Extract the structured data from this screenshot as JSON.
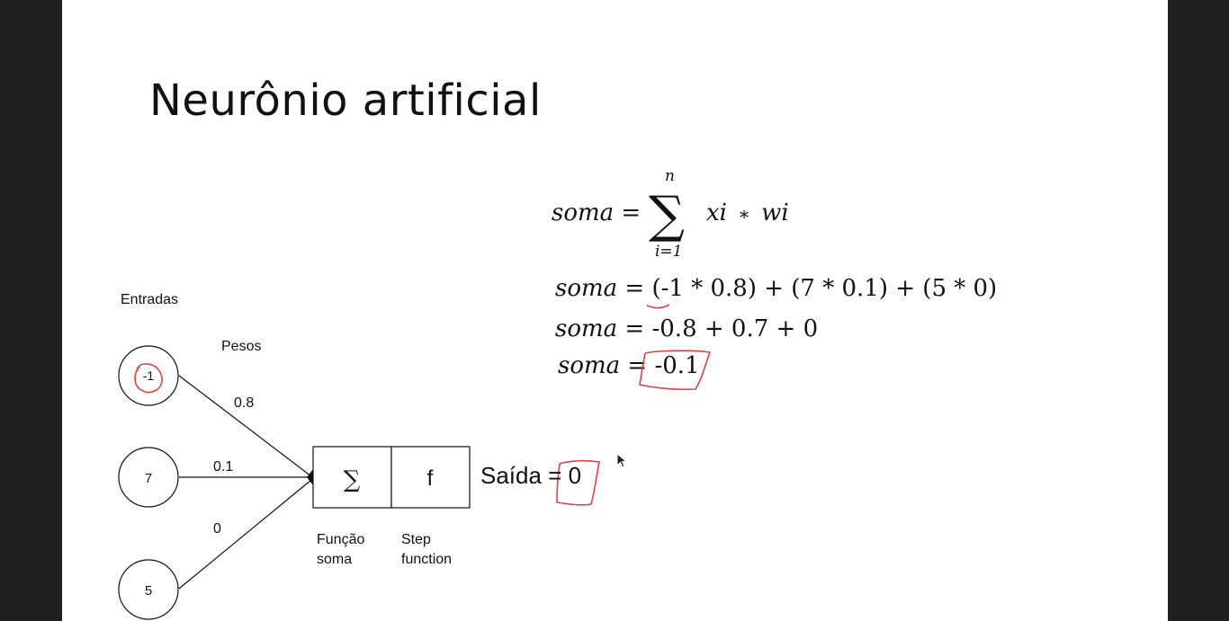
{
  "slide": {
    "title": "Neurônio artificial"
  },
  "formula": {
    "main_lhs": "soma",
    "main_eq": "=",
    "sum_symbol": "∑",
    "sum_upper": "n",
    "sum_lower": "i=1",
    "term_x": "xi",
    "term_op": "∗",
    "term_w": "wi",
    "lines": [
      {
        "lhs": "soma",
        "rhs": "= (-1 * 0.8) + (7 * 0.1) + (5 * 0)"
      },
      {
        "lhs": "soma",
        "rhs": "= -0.8 + 0.7 + 0"
      },
      {
        "lhs": "soma",
        "rhs": "= -0.1"
      }
    ]
  },
  "diagram": {
    "inputs_label": "Entradas",
    "weights_label": "Pesos",
    "inputs": [
      "-1",
      "7",
      "5"
    ],
    "weights": [
      "0.8",
      "0.1",
      "0"
    ],
    "sum_box_symbol": "∑",
    "activation_box_symbol": "f",
    "sum_caption_line1": "Função",
    "sum_caption_line2": "soma",
    "activation_caption_line1": "Step",
    "activation_caption_line2": "function",
    "output_text": "Saída = 0"
  },
  "colors": {
    "annotation": "#e0403f",
    "text": "#111111",
    "background": "#202020",
    "slide": "#ffffff"
  },
  "icons": {
    "cursor": "mouse-pointer-icon"
  }
}
